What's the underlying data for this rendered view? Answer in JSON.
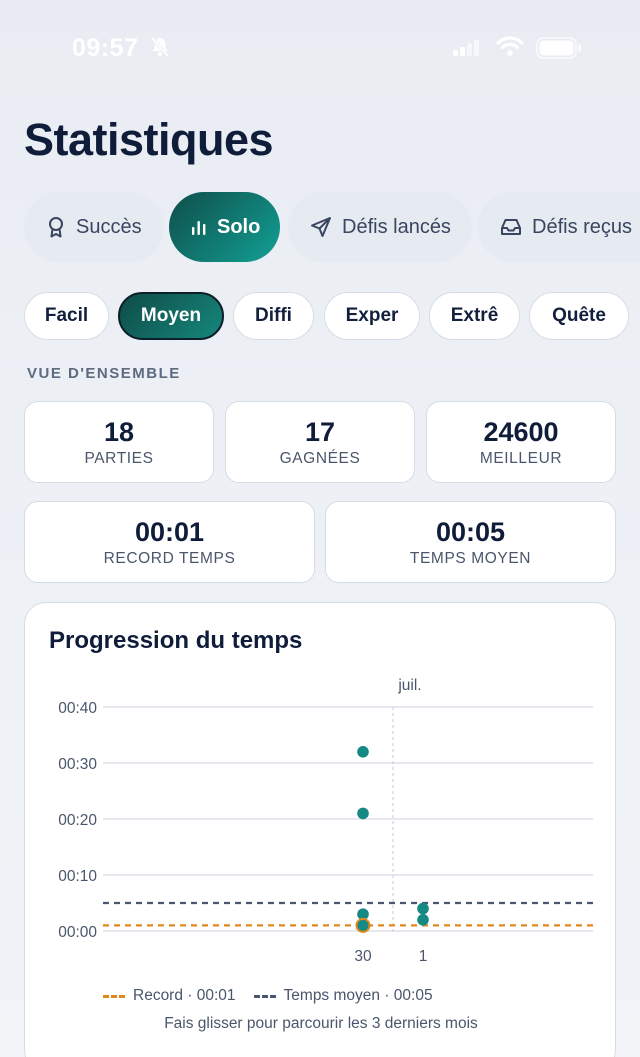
{
  "status_bar": {
    "time": "09:57"
  },
  "title": "Statistiques",
  "tabs": [
    {
      "label": "Succès",
      "icon": "award-icon",
      "active": false
    },
    {
      "label": "Solo",
      "icon": "bar-chart-icon",
      "active": true
    },
    {
      "label": "Défis lancés",
      "icon": "send-icon",
      "active": false
    },
    {
      "label": "Défis reçus",
      "icon": "inbox-icon",
      "active": false
    }
  ],
  "difficulties": [
    {
      "label": "Facil",
      "active": false
    },
    {
      "label": "Moyen",
      "active": true
    },
    {
      "label": "Diffi",
      "active": false
    },
    {
      "label": "Exper",
      "active": false
    },
    {
      "label": "Extrê",
      "active": false
    },
    {
      "label": "Quête",
      "active": false
    }
  ],
  "overview": {
    "section_label": "VUE D'ENSEMBLE",
    "stats": [
      {
        "value": "18",
        "label": "PARTIES"
      },
      {
        "value": "17",
        "label": "GAGNÉES"
      },
      {
        "value": "24600",
        "label": "MEILLEUR"
      },
      {
        "value": "00:01",
        "label": "RECORD TEMPS"
      },
      {
        "value": "00:05",
        "label": "TEMPS MOYEN"
      }
    ]
  },
  "chart": {
    "title": "Progression du temps",
    "month_label": "juil.",
    "legend": {
      "record": "Record · 00:01",
      "average": "Temps moyen · 00:05"
    },
    "hint": "Fais glisser pour parcourir les 3 derniers mois"
  },
  "colors": {
    "accent": "#12a094",
    "point": "#158a84",
    "record_line": "#e08a1e",
    "average_line": "#4a5670"
  },
  "chart_data": {
    "type": "scatter",
    "title": "Progression du temps",
    "x_ticks": [
      "30",
      "1"
    ],
    "month_marker": "juil.",
    "y_ticks": [
      "00:00",
      "00:10",
      "00:20",
      "00:30",
      "00:40"
    ],
    "ylim_seconds": [
      0,
      40
    ],
    "series": [
      {
        "points": [
          {
            "x": "30",
            "y": 32
          },
          {
            "x": "30",
            "y": 21
          },
          {
            "x": "30",
            "y": 3
          },
          {
            "x": "30",
            "y": 1,
            "highlight": true
          },
          {
            "x": "1",
            "y": 4
          },
          {
            "x": "1",
            "y": 2
          }
        ]
      }
    ],
    "reference_lines": [
      {
        "name": "Record",
        "y": 1,
        "style": "dashed"
      },
      {
        "name": "Temps moyen",
        "y": 5,
        "style": "dashed"
      }
    ],
    "grid": true,
    "legend_position": "bottom"
  }
}
